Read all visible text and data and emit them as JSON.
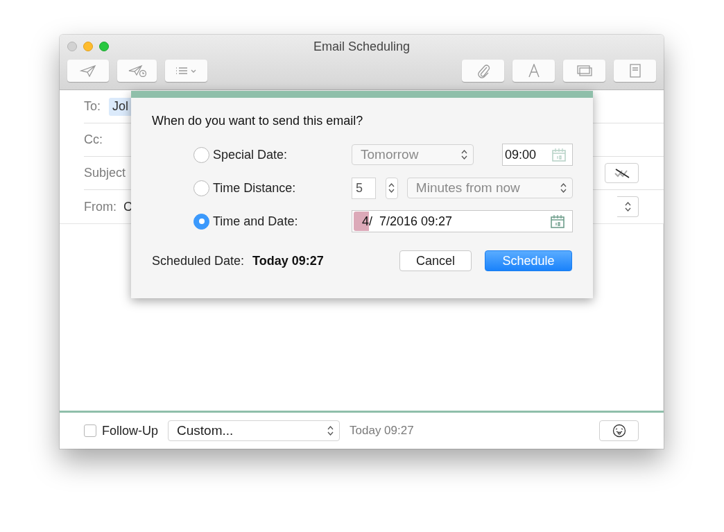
{
  "window": {
    "title": "Email Scheduling",
    "controls": [
      {
        "kind": "close",
        "disabled": true
      },
      {
        "kind": "minimize",
        "disabled": false
      },
      {
        "kind": "zoom",
        "disabled": false
      }
    ]
  },
  "toolbar": {
    "left": [
      {
        "kind": "send"
      },
      {
        "kind": "send-later"
      },
      {
        "kind": "list-menu"
      }
    ],
    "right": [
      {
        "kind": "attach"
      },
      {
        "kind": "font"
      },
      {
        "kind": "windows"
      },
      {
        "kind": "note"
      }
    ]
  },
  "compose": {
    "fields": [
      {
        "kind": "recipient",
        "label": "To:",
        "value": "Jol"
      },
      {
        "kind": "text",
        "label": "Cc:"
      },
      {
        "kind": "subject",
        "label": "Subject"
      },
      {
        "kind": "popup",
        "label": "From:",
        "value": "C"
      }
    ]
  },
  "dialog": {
    "question": "When do you want to send this email?",
    "options": [
      {
        "kind": "special",
        "label": "Special Date:",
        "selected": false,
        "popup": {
          "value": "Tomorrow",
          "disabled": true
        },
        "time": "09:00"
      },
      {
        "kind": "distance",
        "label": "Time Distance:",
        "selected": false,
        "amount": "5",
        "popup": {
          "value": "Minutes from now",
          "disabled": true
        }
      },
      {
        "kind": "datetime",
        "label": "Time and Date:",
        "selected": true,
        "segments": [
          {
            "text": "4",
            "selected": true
          },
          {
            "text": "/  7/2016 09:27",
            "selected": false
          }
        ]
      }
    ],
    "scheduled_label": "Scheduled Date:",
    "scheduled_value": "Today 09:27",
    "buttons": [
      {
        "label": "Cancel",
        "default": false
      },
      {
        "label": "Schedule",
        "default": true
      }
    ]
  },
  "bottom_bar": {
    "follow_up": {
      "label": "Follow-Up",
      "checked": false
    },
    "popup": "Custom...",
    "time": "Today 09:27"
  }
}
